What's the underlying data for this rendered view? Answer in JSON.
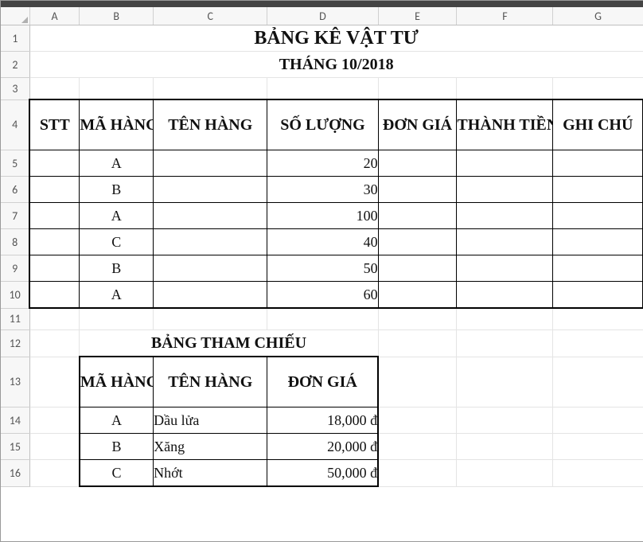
{
  "columns": [
    "A",
    "B",
    "C",
    "D",
    "E",
    "F",
    "G"
  ],
  "rowLabels": [
    "1",
    "2",
    "3",
    "4",
    "5",
    "6",
    "7",
    "8",
    "9",
    "10",
    "11",
    "12",
    "13",
    "14",
    "15",
    "16"
  ],
  "title": "BẢNG KÊ VẬT TƯ",
  "subtitle": "THÁNG 10/2018",
  "mainHeaders": {
    "stt": "STT",
    "maHang": "MÃ HÀNG",
    "tenHang": "TÊN HÀNG",
    "soLuong": "SỐ LƯỢNG",
    "donGia": "ĐƠN GIÁ",
    "thanhTien": "THÀNH TIỀN",
    "ghiChu": "GHI CHÚ"
  },
  "mainRows": [
    {
      "ma": "A",
      "sl": "20"
    },
    {
      "ma": "B",
      "sl": "30"
    },
    {
      "ma": "A",
      "sl": "100"
    },
    {
      "ma": "C",
      "sl": "40"
    },
    {
      "ma": "B",
      "sl": "50"
    },
    {
      "ma": "A",
      "sl": "60"
    }
  ],
  "refTitle": "BẢNG THAM CHIẾU",
  "refHeaders": {
    "maHang": "MÃ HÀNG",
    "tenHang": "TÊN HÀNG",
    "donGia": "ĐƠN GIÁ"
  },
  "refRows": [
    {
      "ma": "A",
      "ten": "Dầu lửa",
      "gia": "18,000 đ"
    },
    {
      "ma": "B",
      "ten": "Xăng",
      "gia": "20,000 đ"
    },
    {
      "ma": "C",
      "ten": "Nhớt",
      "gia": "50,000 đ"
    }
  ]
}
